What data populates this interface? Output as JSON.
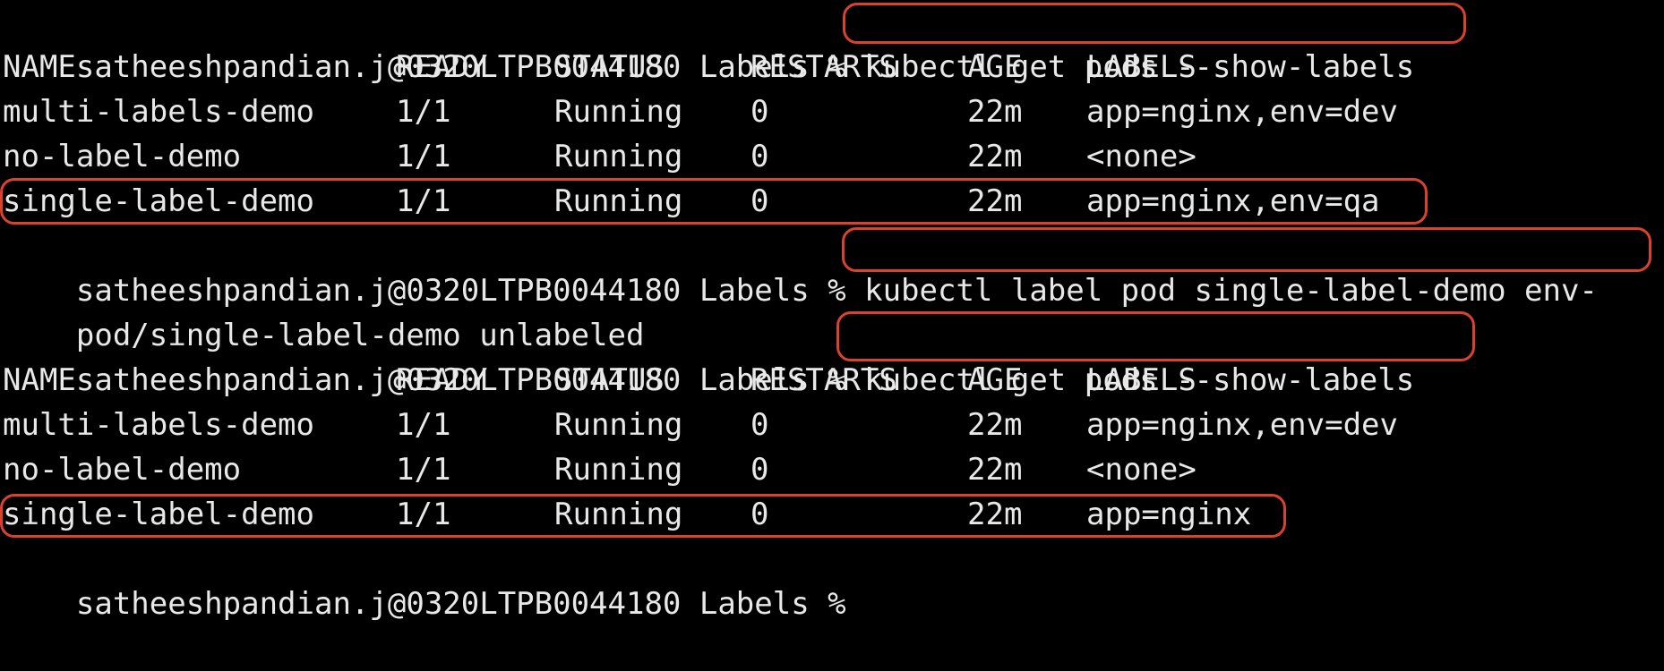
{
  "terminal": {
    "prompt": "satheeshpandian.j@0320LTPB0044180 Labels % ",
    "commands": {
      "get_pods_1": "kubectl get pods --show-labels",
      "label_remove": "kubectl label pod single-label-demo env-",
      "get_pods_2": "kubectl get pods --show-labels"
    },
    "label_output": "pod/single-label-demo unlabeled",
    "table_headers": {
      "name": "NAME",
      "ready": "READY",
      "status": "STATUS",
      "restarts": "RESTARTS",
      "age": "AGE",
      "labels": "LABELS"
    },
    "table_1": [
      {
        "name": "multi-labels-demo",
        "ready": "1/1",
        "status": "Running",
        "restarts": "0",
        "age": "22m",
        "labels": "app=nginx,env=dev"
      },
      {
        "name": "no-label-demo",
        "ready": "1/1",
        "status": "Running",
        "restarts": "0",
        "age": "22m",
        "labels": "<none>"
      },
      {
        "name": "single-label-demo",
        "ready": "1/1",
        "status": "Running",
        "restarts": "0",
        "age": "22m",
        "labels": "app=nginx,env=qa"
      }
    ],
    "table_2": [
      {
        "name": "multi-labels-demo",
        "ready": "1/1",
        "status": "Running",
        "restarts": "0",
        "age": "22m",
        "labels": "app=nginx,env=dev"
      },
      {
        "name": "no-label-demo",
        "ready": "1/1",
        "status": "Running",
        "restarts": "0",
        "age": "22m",
        "labels": "<none>"
      },
      {
        "name": "single-label-demo",
        "ready": "1/1",
        "status": "Running",
        "restarts": "0",
        "age": "22m",
        "labels": "app=nginx"
      }
    ]
  },
  "colors": {
    "background": "#000000",
    "text": "#e8e8e8",
    "highlight": "#d9432e"
  }
}
